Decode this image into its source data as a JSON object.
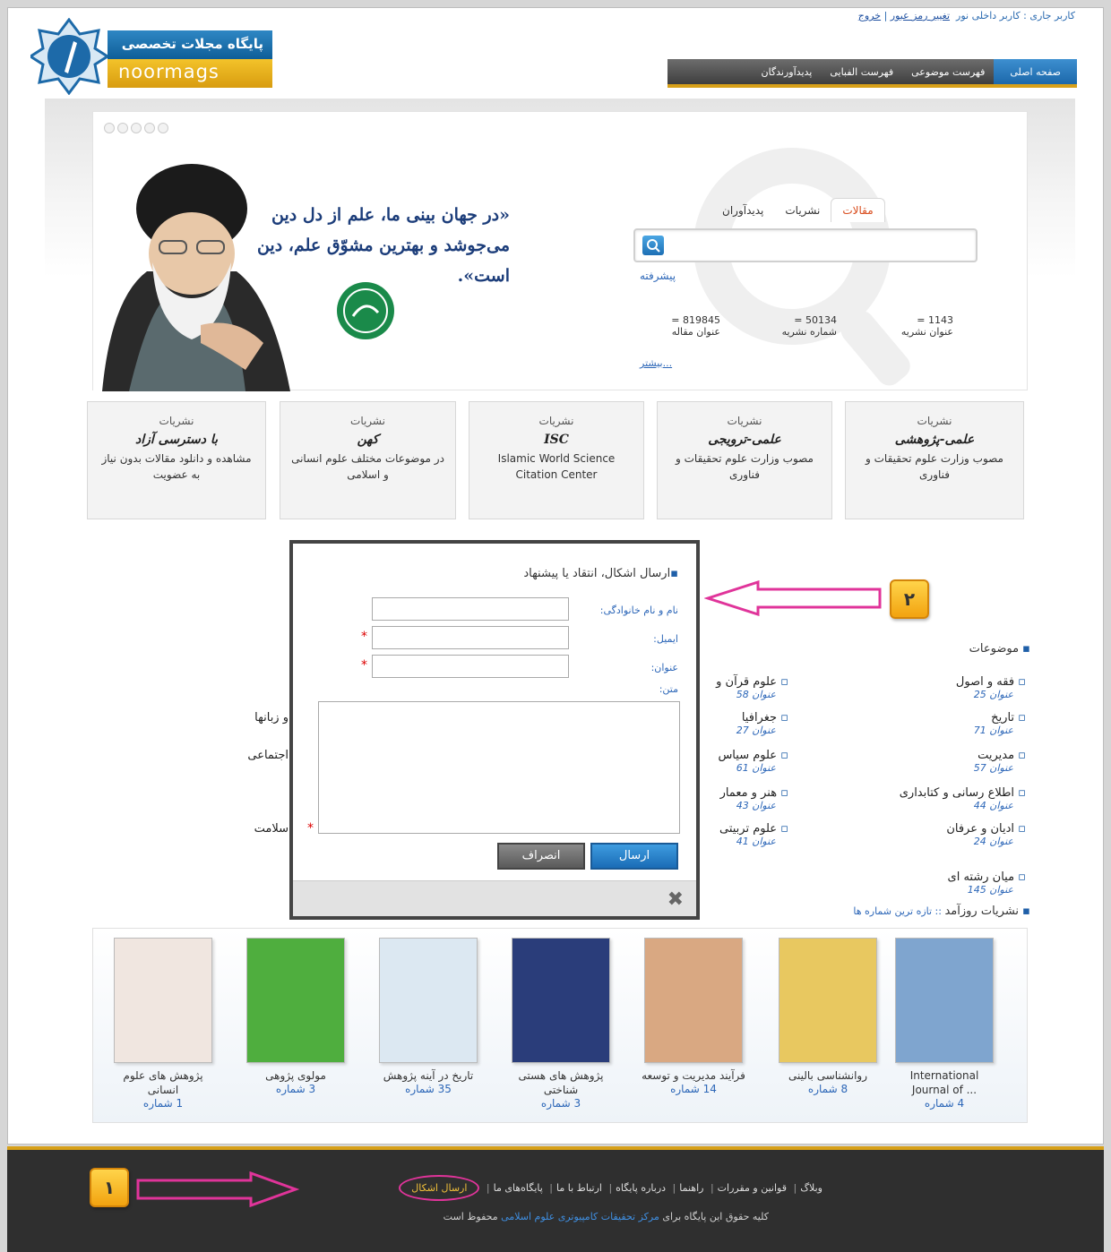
{
  "header": {
    "logo_title": "پایگاه مجلات تخصصی",
    "logo_sub": "noormags",
    "user_prefix": "کاربر جاری : ",
    "user_name": "کاربر داخلی نور",
    "change_password": "تغییر رمز عبور",
    "sep": " | ",
    "logout": "خروج",
    "nav": [
      "صفحه اصلی",
      "فهرست موضوعی",
      "فهرست الفبایی",
      "پدیدآورندگان"
    ]
  },
  "hero": {
    "quote": "«در جهان بینی ما، علم از دل دین می‌جوشد و بهترین مشوّق علم، دین است».",
    "search_tabs": [
      "مقالات",
      "نشریات",
      "پدیدآوران"
    ],
    "search_placeholder": "",
    "advanced": "پیشرفته",
    "stats": [
      {
        "value": "819845 =",
        "label": "عنوان مقاله"
      },
      {
        "value": "50134 =",
        "label": "شماره نشریه"
      },
      {
        "value": "1143 =",
        "label": "عنوان نشریه"
      }
    ],
    "more": "بیشتر..."
  },
  "categories": [
    {
      "t1": "نشریات",
      "t2": "علمی-پژوهشی",
      "t3": "مصوب وزارت علوم تحقیقات و فناوری"
    },
    {
      "t1": "نشریات",
      "t2": "علمی-ترویجی",
      "t3": "مصوب وزارت علوم تحقیقات و فناوری"
    },
    {
      "t1": "نشریات",
      "t2": "ISC",
      "t3": "Islamic World Science Citation Center"
    },
    {
      "t1": "نشریات",
      "t2": "کهن",
      "t3": "در موضوعات مختلف علوم انسانی و اسلامی"
    },
    {
      "t1": "نشریات",
      "t2": "با دسترسی آزاد",
      "t3": "مشاهده و دانلود مقالات بدون نیاز به عضویت"
    }
  ],
  "subjects": {
    "title": "موضوعات",
    "col1": [
      {
        "name": "فقه و اصول",
        "count": "عنوان 25"
      },
      {
        "name": "تاریخ",
        "count": "عنوان 71"
      },
      {
        "name": "مدیریت",
        "count": "عنوان 57"
      },
      {
        "name": "اطلاع رسانی و کتابداری",
        "count": "عنوان 44"
      },
      {
        "name": "ادیان و عرفان",
        "count": "عنوان 24"
      },
      {
        "name": "میان رشته ای",
        "count": "عنوان 145"
      }
    ],
    "col2": [
      {
        "name": "علوم قرآن و",
        "count": "عنوان 58"
      },
      {
        "name": "جغرافیا",
        "count": "عنوان 27"
      },
      {
        "name": "علوم سیاس",
        "count": "عنوان 61"
      },
      {
        "name": "هنر و معمار",
        "count": "عنوان 43"
      },
      {
        "name": "علوم تربیتی",
        "count": "عنوان 41"
      }
    ],
    "col3": [
      "",
      "و زبانها",
      "اجتماعی",
      "",
      "سلامت"
    ]
  },
  "modal": {
    "title": "ارسال اشکال، انتقاد یا پیشنهاد",
    "name_label": "نام و نام خانوادگی:",
    "email_label": "ایمیل:",
    "subject_label": "عنوان:",
    "text_label": "متن:",
    "send": "ارسال",
    "cancel": "انصراف",
    "close": "✖"
  },
  "badges": {
    "one": "۱",
    "two": "۲"
  },
  "issues": {
    "title": "نشریات روزآمد",
    "subtitle": " :: تازه ترین شماره ها",
    "books": [
      {
        "name": "International Journal of ...",
        "num": "4 شماره",
        "color": "#7fa5cf"
      },
      {
        "name": "روانشناسی بالینی",
        "num": "8 شماره",
        "color": "#e8c860"
      },
      {
        "name": "فرآیند مدیریت و توسعه",
        "num": "14 شماره",
        "color": "#d9a882"
      },
      {
        "name": "پژوهش های هستی شناختی",
        "num": "3 شماره",
        "color": "#2a3d7a"
      },
      {
        "name": "تاریخ در آینه پژوهش",
        "num": "35 شماره",
        "color": "#dce8f2"
      },
      {
        "name": "مولوی پژوهی",
        "num": "3 شماره",
        "color": "#4fae3e"
      },
      {
        "name": "پژوهش های علوم انسانی",
        "num": "1 شماره",
        "color": "#f0e6e0"
      }
    ]
  },
  "footer": {
    "links": [
      "وبلاگ",
      "قوانین و مقررات",
      "راهنما",
      "درباره پایگاه",
      "ارتباط با ما",
      "پایگاه‌های ما",
      "ارسال اشکال"
    ],
    "copy_a": "کلیه حقوق این پایگاه برای ",
    "copy_link": "مرکز تحقیقات کامپیوتری علوم اسلامی",
    "copy_b": " محفوظ است"
  }
}
